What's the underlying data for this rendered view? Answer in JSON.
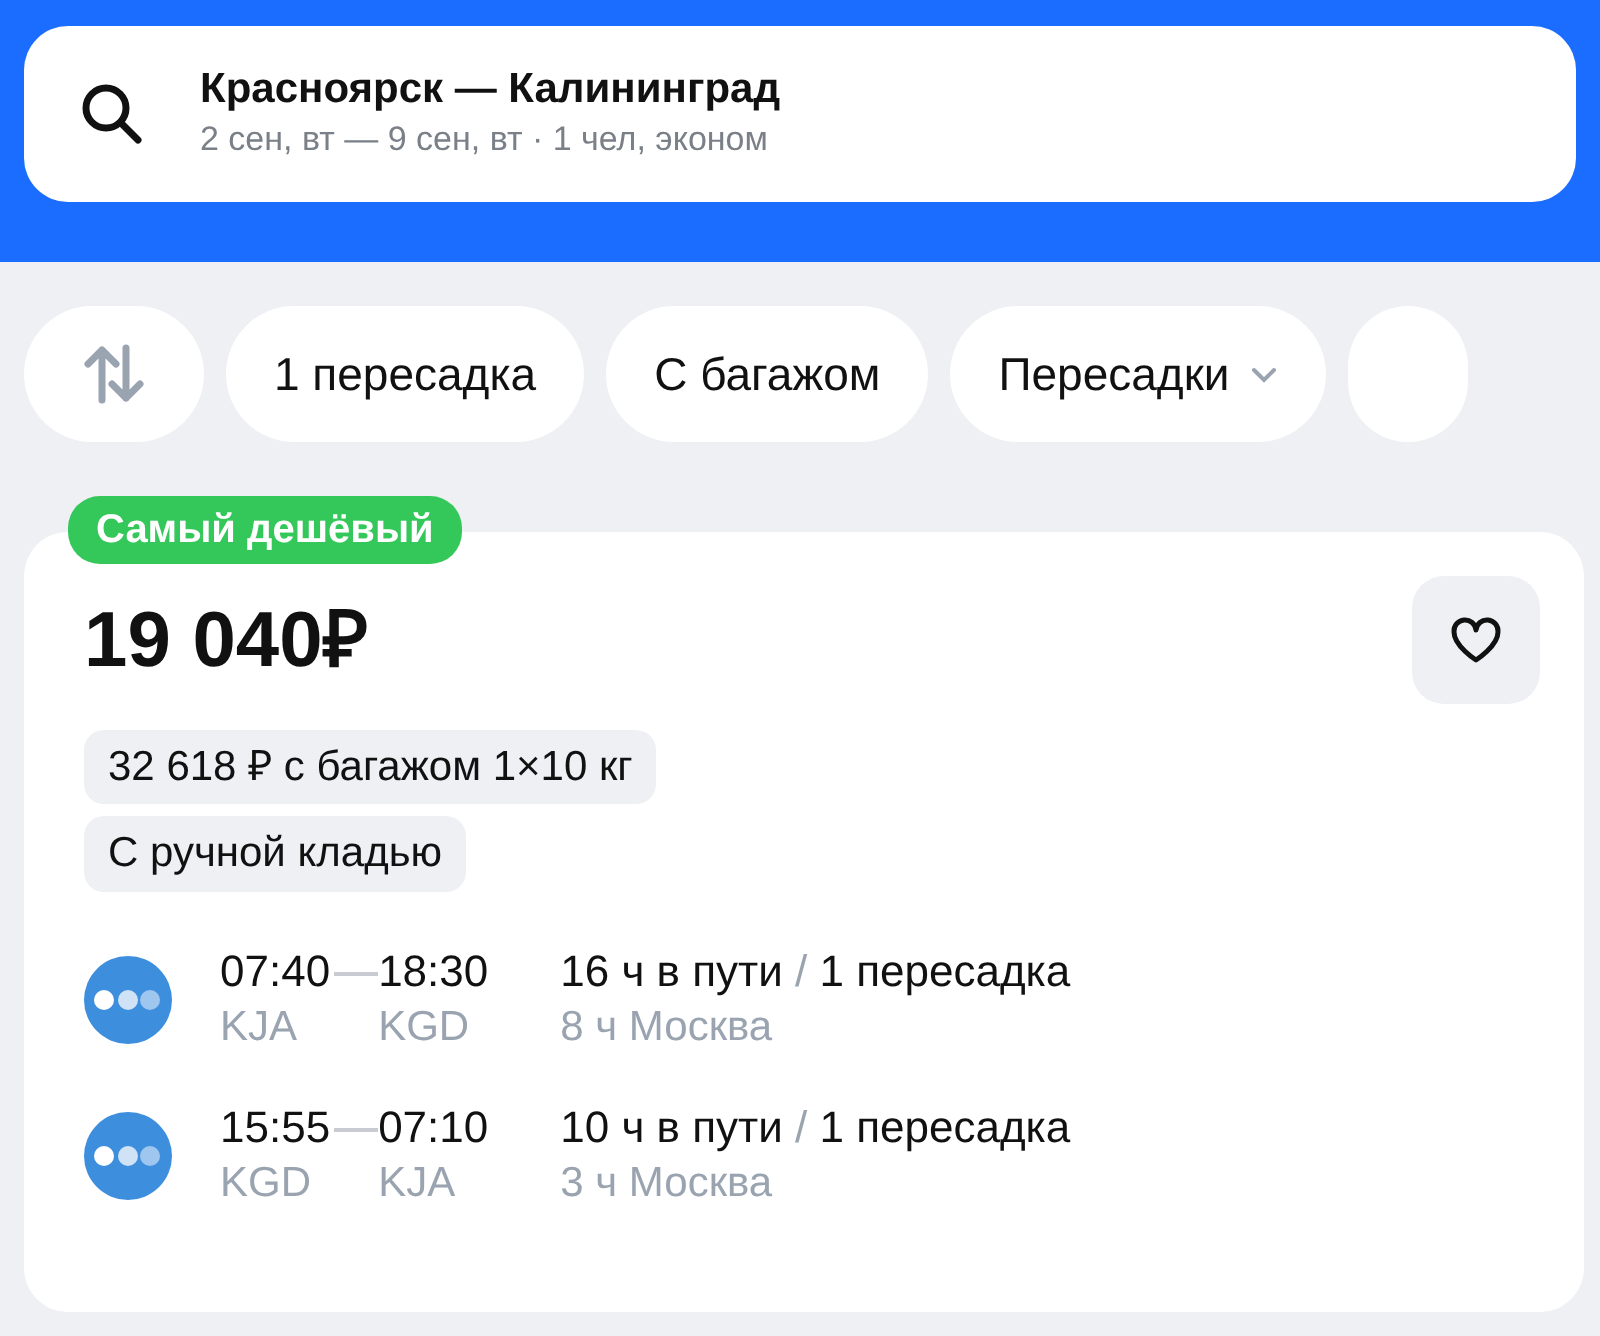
{
  "search": {
    "route": "Красноярск — Калининград",
    "details": "2 сен, вт — 9 сен, вт · 1 чел, эконом"
  },
  "filters": [
    {
      "label": "1 пересадка",
      "dropdown": false
    },
    {
      "label": "С багажом",
      "dropdown": false
    },
    {
      "label": "Пересадки",
      "dropdown": true
    }
  ],
  "ticket": {
    "badge": "Самый дешёвый",
    "price": "19 040₽",
    "favorite": false,
    "tags": [
      "32 618 ₽ с багажом 1×10 кг",
      "С ручной кладью"
    ],
    "flights": [
      {
        "depart_time": "07:40",
        "arrive_time": "18:30",
        "depart_airport": "KJA",
        "arrive_airport": "KGD",
        "duration": "16 ч в пути",
        "separator": "/",
        "stops": "1 пересадка",
        "layover": "8 ч Москва"
      },
      {
        "depart_time": "15:55",
        "arrive_time": "07:10",
        "depart_airport": "KGD",
        "arrive_airport": "KJA",
        "duration": "10 ч в пути",
        "separator": "/",
        "stops": "1 пересадка",
        "layover": "3 ч Москва"
      }
    ]
  }
}
